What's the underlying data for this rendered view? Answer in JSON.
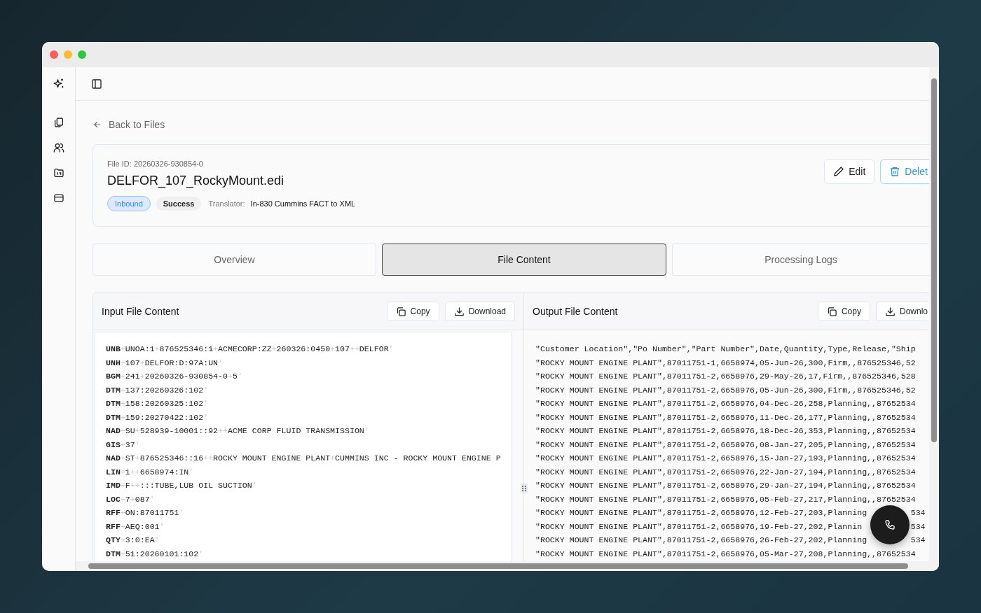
{
  "sidebar": {
    "items": [
      {
        "selected": false
      },
      {
        "selected": false
      },
      {
        "selected": false
      },
      {
        "selected": false
      }
    ]
  },
  "back_link": "Back to Files",
  "file": {
    "id_label": "File ID: 20260326-930854-0",
    "name": "DELFOR_107_RockyMount.edi",
    "badges": [
      {
        "label": "Inbound",
        "kind": "direction"
      },
      {
        "label": "Success",
        "kind": "status"
      }
    ],
    "translator_label": "Translator:",
    "translator": "In-830 Cummins FACT to XML",
    "actions": [
      {
        "label": "Edit",
        "kind": "edit"
      },
      {
        "label": "Delet",
        "kind": "delete"
      }
    ]
  },
  "tabs": [
    {
      "label": "Overview",
      "selected": false
    },
    {
      "label": "File Content",
      "selected": true
    },
    {
      "label": "Processing Logs",
      "selected": false
    }
  ],
  "input_panel": {
    "title": "Input File Content",
    "buttons": [
      {
        "label": "Copy",
        "kind": "copy"
      },
      {
        "label": "Download",
        "kind": "download"
      }
    ],
    "lines": [
      {
        "tag": "UNB",
        "text": "+UNOA:1+876525346:1+ACMECORP:ZZ+260326:0450+107++DELFOR'"
      },
      {
        "tag": "UNH",
        "text": "+107+DELFOR:D:97A:UN'"
      },
      {
        "tag": "BGM",
        "text": "+241+20260326-930854-0+5'"
      },
      {
        "tag": "DTM",
        "text": "+137:20260326:102'"
      },
      {
        "tag": "DTM",
        "text": "+158:20260325:102'"
      },
      {
        "tag": "DTM",
        "text": "+159:20270422:102'"
      },
      {
        "tag": "NAD",
        "text": "+SU+528939-10001::92++ACME CORP FLUID TRANSMISSION'"
      },
      {
        "tag": "GIS",
        "text": "+37'"
      },
      {
        "tag": "NAD",
        "text": "+ST+876525346::16++ROCKY MOUNT ENGINE PLANT+CUMMINS INC - ROCKY MOUNT ENGINE P"
      },
      {
        "tag": "LIN",
        "text": "+1++6658974:IN'"
      },
      {
        "tag": "IMD",
        "text": "+F++:::TUBE,LUB OIL SUCTION'"
      },
      {
        "tag": "LOC",
        "text": "+7+087'"
      },
      {
        "tag": "RFF",
        "text": "+ON:87011751'"
      },
      {
        "tag": "RFF",
        "text": "+AEQ:001'"
      },
      {
        "tag": "QTY",
        "text": "+3:0:EA'"
      },
      {
        "tag": "DTM",
        "text": "+51:20260101:102'"
      }
    ]
  },
  "output_panel": {
    "title": "Output File Content",
    "buttons": [
      {
        "label": "Copy",
        "kind": "copy"
      },
      {
        "label": "Downlo",
        "kind": "download"
      }
    ],
    "lines": [
      "\"Customer Location\",\"Po Number\",\"Part Number\",Date,Quantity,Type,Release,\"Ship",
      "\"ROCKY MOUNT ENGINE PLANT\",87011751-1,6658974,05-Jun-26,300,Firm,,876525346,52",
      "\"ROCKY MOUNT ENGINE PLANT\",87011751-2,6658976,29-May-26,17,Firm,,876525346,528",
      "\"ROCKY MOUNT ENGINE PLANT\",87011751-2,6658976,05-Jun-26,300,Firm,,876525346,52",
      "\"ROCKY MOUNT ENGINE PLANT\",87011751-2,6658976,04-Dec-26,258,Planning,,87652534",
      "\"ROCKY MOUNT ENGINE PLANT\",87011751-2,6658976,11-Dec-26,177,Planning,,87652534",
      "\"ROCKY MOUNT ENGINE PLANT\",87011751-2,6658976,18-Dec-26,353,Planning,,87652534",
      "\"ROCKY MOUNT ENGINE PLANT\",87011751-2,6658976,08-Jan-27,205,Planning,,87652534",
      "\"ROCKY MOUNT ENGINE PLANT\",87011751-2,6658976,15-Jan-27,193,Planning,,87652534",
      "\"ROCKY MOUNT ENGINE PLANT\",87011751-2,6658976,22-Jan-27,194,Planning,,87652534",
      "\"ROCKY MOUNT ENGINE PLANT\",87011751-2,6658976,29-Jan-27,194,Planning,,87652534",
      "\"ROCKY MOUNT ENGINE PLANT\",87011751-2,6658976,05-Feb-27,217,Planning,,87652534",
      {
        "text": "\"ROCKY MOUNT ENGINE PLANT\",87011751-2,6658976,12-Feb-27,203,Planning",
        "tail": "534"
      },
      {
        "text": "\"ROCKY MOUNT ENGINE PLANT\",87011751-2,6658976,19-Feb-27,202,Plannin",
        "tail": "534"
      },
      {
        "text": "\"ROCKY MOUNT ENGINE PLANT\",87011751-2,6658976,26-Feb-27,202,Planning",
        "tail": "534"
      },
      "\"ROCKY MOUNT ENGINE PLANT\",87011751-2,6658976,05-Mar-27,208,Planning,,87652534"
    ]
  }
}
